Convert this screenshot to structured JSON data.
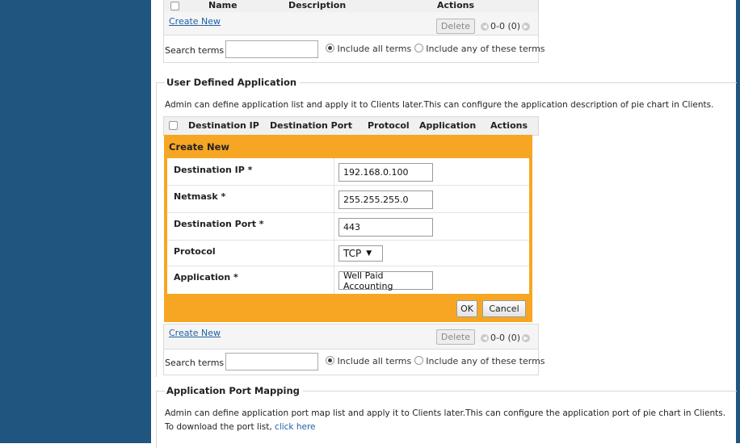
{
  "top_table": {
    "headers": [
      "Name",
      "Description",
      "Actions"
    ],
    "create_new": "Create New",
    "delete_label": "Delete",
    "pager_text": "0-0 (0)",
    "search_label": "Search terms",
    "search_value": "",
    "include_all": "Include all terms",
    "include_any": "Include any of these terms"
  },
  "user_defined": {
    "legend": "User Defined Application",
    "description": "Admin can define application list and apply it to Clients later.This can configure the application description of pie chart in Clients.",
    "headers": [
      "Destination IP",
      "Destination Port",
      "Protocol",
      "Application",
      "Actions"
    ],
    "create_panel": {
      "title": "Create New",
      "fields": [
        {
          "label": "Destination IP *",
          "value": "192.168.0.100"
        },
        {
          "label": "Netmask *",
          "value": "255.255.255.0"
        },
        {
          "label": "Destination Port *",
          "value": "443"
        },
        {
          "label": "Protocol",
          "value": "TCP"
        },
        {
          "label": "Application *",
          "value": "Well Paid Accounting"
        }
      ],
      "ok_label": "OK",
      "cancel_label": "Cancel"
    },
    "create_new": "Create New",
    "delete_label": "Delete",
    "pager_text": "0-0 (0)",
    "search_label": "Search terms",
    "search_value": "",
    "include_all": "Include all terms",
    "include_any": "Include any of these terms"
  },
  "port_mapping": {
    "legend": "Application Port Mapping",
    "description": "Admin can define application port map list and apply it to Clients later.This can configure the application port of pie chart in Clients.",
    "download_text": "To download the port list,",
    "download_link": "click here"
  },
  "colors": {
    "sidebar": "#205580",
    "panel_orange": "#f7a623",
    "link_blue": "#1f5fa6"
  }
}
